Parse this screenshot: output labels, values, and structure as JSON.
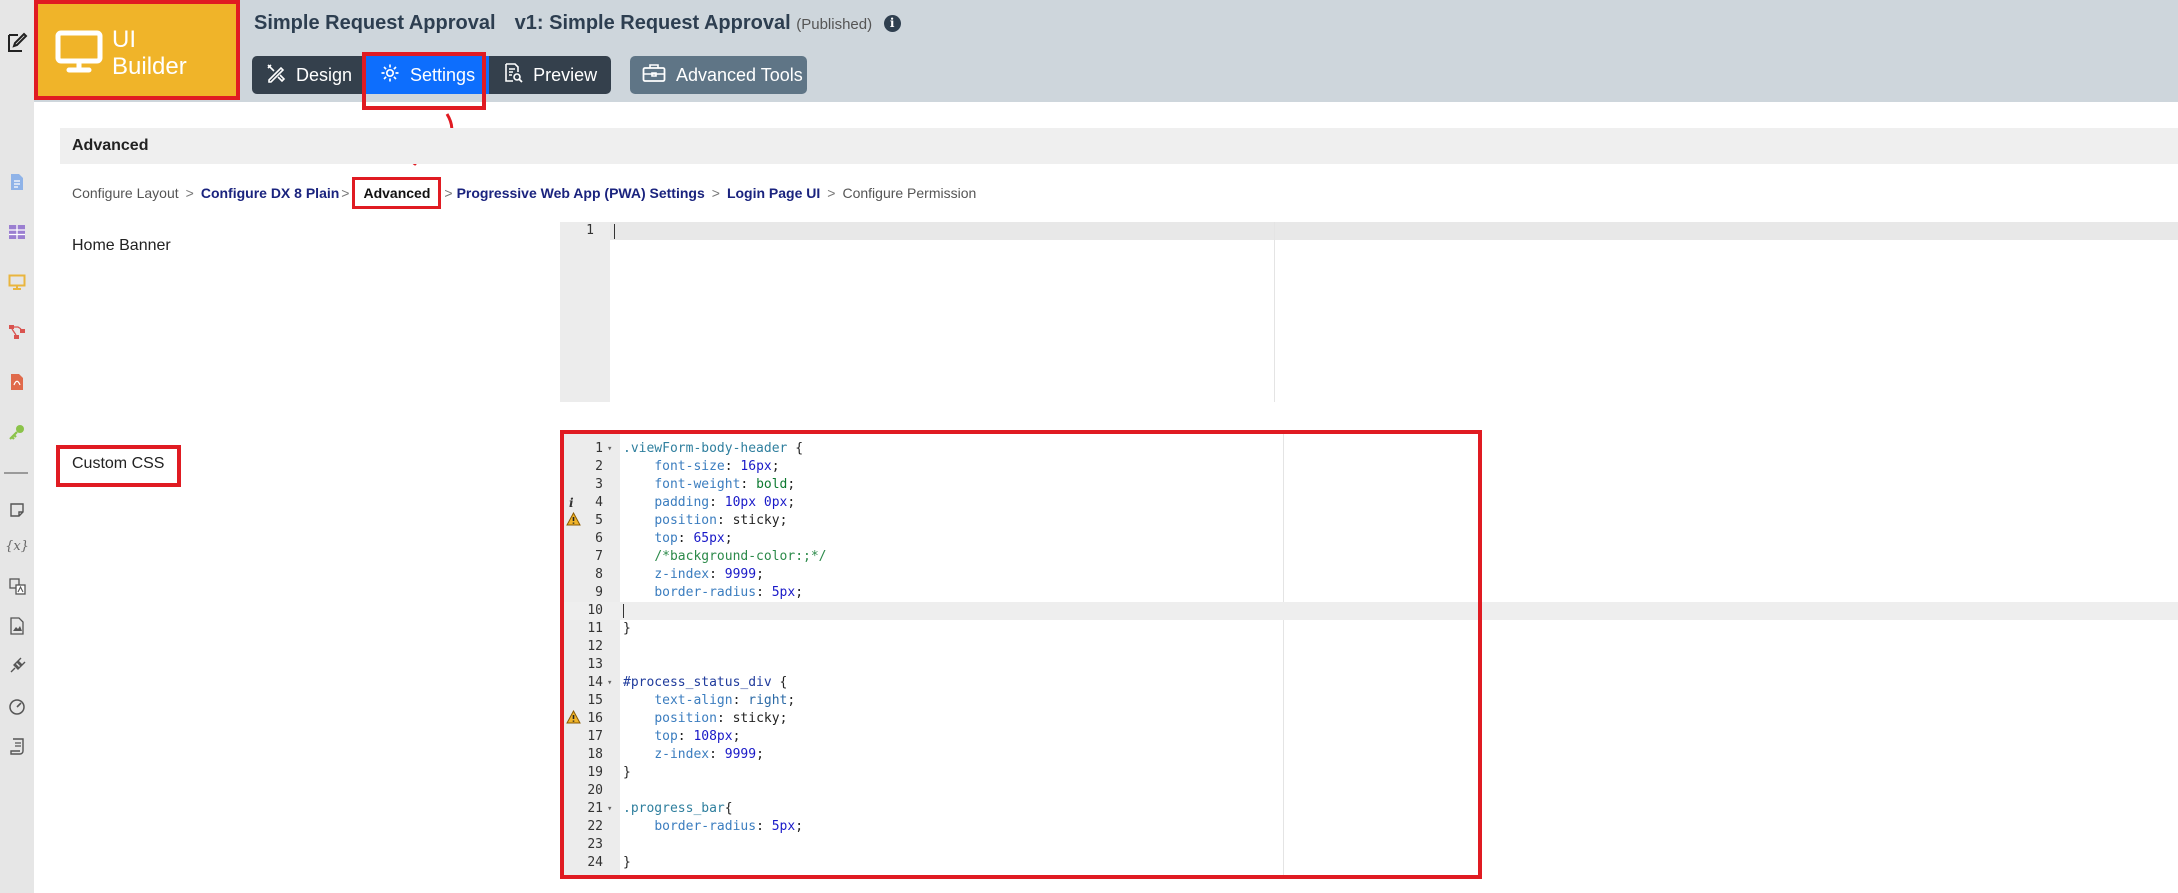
{
  "header": {
    "logo": {
      "line1": "UI",
      "line2": "Builder",
      "icon": "monitor-icon"
    },
    "app_title": "Simple Request Approval",
    "version_title": "v1: Simple Request Approval",
    "status": "(Published)",
    "info_icon": "info-icon",
    "tabs": [
      {
        "label": "Design",
        "icon": "pencil-ruler-icon"
      },
      {
        "label": "Settings",
        "icon": "gear-icon"
      },
      {
        "label": "Preview",
        "icon": "document-search-icon"
      }
    ],
    "advanced_tools": {
      "label": "Advanced Tools",
      "icon": "toolbox-icon"
    }
  },
  "left_rail": {
    "icons": [
      "edit-icon",
      "document-icon",
      "table-icon",
      "monitor-icon",
      "process-flow-icon",
      "pdf-icon",
      "key-icon",
      "note-icon",
      "variable-icon",
      "translate-icon",
      "image-icon",
      "plugin-icon",
      "gauge-icon",
      "scroll-icon"
    ]
  },
  "section": {
    "title": "Advanced"
  },
  "breadcrumb": {
    "items": [
      {
        "label": "Configure Layout",
        "state": "plain"
      },
      {
        "label": "Configure DX 8 Plain",
        "state": "link"
      },
      {
        "label": "Advanced",
        "state": "current"
      },
      {
        "label": "Progressive Web App (PWA) Settings",
        "state": "link"
      },
      {
        "label": "Login Page UI",
        "state": "link"
      },
      {
        "label": "Configure Permission",
        "state": "plain"
      }
    ],
    "separator": ">"
  },
  "fields": {
    "home_banner": {
      "label": "Home Banner",
      "lines": [
        "1"
      ]
    },
    "custom_css": {
      "label": "Custom CSS"
    }
  },
  "code": {
    "lines": [
      {
        "n": "1",
        "fold": true,
        "text": ".viewForm-body-header {"
      },
      {
        "n": "2",
        "text": "    font-size: 16px;"
      },
      {
        "n": "3",
        "text": "    font-weight: bold;"
      },
      {
        "n": "4",
        "gutter": "i",
        "text": "    padding: 10px 0px;"
      },
      {
        "n": "5",
        "gutter": "warn",
        "text": "    position: sticky;"
      },
      {
        "n": "6",
        "text": "    top: 65px;"
      },
      {
        "n": "7",
        "text": "    /*background-color:;*/"
      },
      {
        "n": "8",
        "text": "    z-index: 9999;"
      },
      {
        "n": "9",
        "text": "    border-radius: 5px;"
      },
      {
        "n": "10",
        "text": ""
      },
      {
        "n": "11",
        "text": "}"
      },
      {
        "n": "12",
        "text": ""
      },
      {
        "n": "13",
        "text": ""
      },
      {
        "n": "14",
        "fold": true,
        "text": "#process_status_div {"
      },
      {
        "n": "15",
        "text": "    text-align: right;"
      },
      {
        "n": "16",
        "gutter": "warn",
        "text": "    position: sticky;"
      },
      {
        "n": "17",
        "text": "    top: 108px;"
      },
      {
        "n": "18",
        "text": "    z-index: 9999;"
      },
      {
        "n": "19",
        "text": "}"
      },
      {
        "n": "20",
        "text": ""
      },
      {
        "n": "21",
        "fold": true,
        "text": ".progress_bar{"
      },
      {
        "n": "22",
        "text": "    border-radius: 5px;"
      },
      {
        "n": "23",
        "text": ""
      },
      {
        "n": "24",
        "text": "}"
      }
    ],
    "active_line": "10"
  },
  "colors": {
    "accent_red": "#e01b22",
    "logo_bg": "#f0b429",
    "tab_active": "#0d6efd",
    "tab_dark": "#34404c",
    "header_bg": "#ced6dc"
  }
}
